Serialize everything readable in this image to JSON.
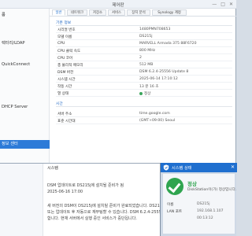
{
  "window": {
    "title": "제어판",
    "close_symbol": "✕",
    "maximize_symbol": "□",
    "minimize_symbol": "—"
  },
  "sidebar": {
    "items": [
      {
        "label": "룹"
      },
      {
        "label": "렉터리/LDAP"
      },
      {
        "label": ""
      },
      {
        "label": "QuickConnect"
      },
      {
        "label": ""
      },
      {
        "label": ""
      },
      {
        "label": ""
      },
      {
        "label": ""
      },
      {
        "label": "DHCP Server"
      },
      {
        "label": ""
      },
      {
        "label": "정보 센터",
        "active": true
      },
      {
        "label": ""
      },
      {
        "label": ""
      }
    ]
  },
  "tabs": [
    {
      "label": "일반",
      "active": true
    },
    {
      "label": "네트워크"
    },
    {
      "label": "저장소"
    },
    {
      "label": "서비스"
    },
    {
      "label": "장치 분석"
    },
    {
      "label": "Synology 계정"
    }
  ],
  "basic_info": {
    "section": "기본 정보",
    "rows": [
      {
        "label": "시리얼 번호",
        "value": "1480PMN708653"
      },
      {
        "label": "모델 이름",
        "value": "DS215j"
      },
      {
        "label": "CPU",
        "value": "MARVELL Armada 375 88F6720"
      },
      {
        "label": "CPU 클럭 속도",
        "value": "800 MHz"
      },
      {
        "label": "CPU 코어",
        "value": "2"
      },
      {
        "label": "총 물리적 메모리",
        "value": "512 MB"
      },
      {
        "label": "DSM 버전",
        "value": "DSM 6.2.4-25556 Update 8"
      },
      {
        "label": "시스템 시간",
        "value": "2025-06-14 17:10:12"
      },
      {
        "label": "작동 시간",
        "value": "13 분 16 초"
      },
      {
        "label": "열 상태",
        "value": "정상",
        "status_color": "#3ba55c"
      }
    ]
  },
  "time_info": {
    "section": "시간",
    "rows": [
      {
        "label": "서버 주소",
        "value": "time.google.com"
      },
      {
        "label": "표준 시간대",
        "value": "(GMT+09:00) Seoul"
      }
    ]
  },
  "dialog": {
    "side_rows": [
      "",
      "",
      "",
      ""
    ],
    "title": "시스템",
    "lines": [
      "DSM 업데이트로 DS215j에 설치될 준비가 됨",
      "2025-06-16 17:00",
      "",
      "새 버전의 DSM이 DS215j에 설치될 준비가 완료되었습니다. DS215j",
      "또는 업데이트 후 자동으로 재부팅할 수 있습니다. DSM 6.2.4-25556 Update 8",
      "합니다. 현재 서버에서 실행 중인 서비스가 중단됩니다."
    ]
  },
  "widget": {
    "title": "시스템 상태",
    "close_symbol": "✕",
    "status": "정상",
    "status_color": "#2fa44f",
    "subtitle": "DiskStation이(가) 정상입니다.",
    "rows": [
      {
        "label": "이름",
        "value": "DS215j"
      },
      {
        "label": "LAN 포트",
        "value": "192.168.1.107"
      },
      {
        "label": "",
        "value": "00:13:12"
      }
    ],
    "accent_color": "#1f6fcf"
  }
}
